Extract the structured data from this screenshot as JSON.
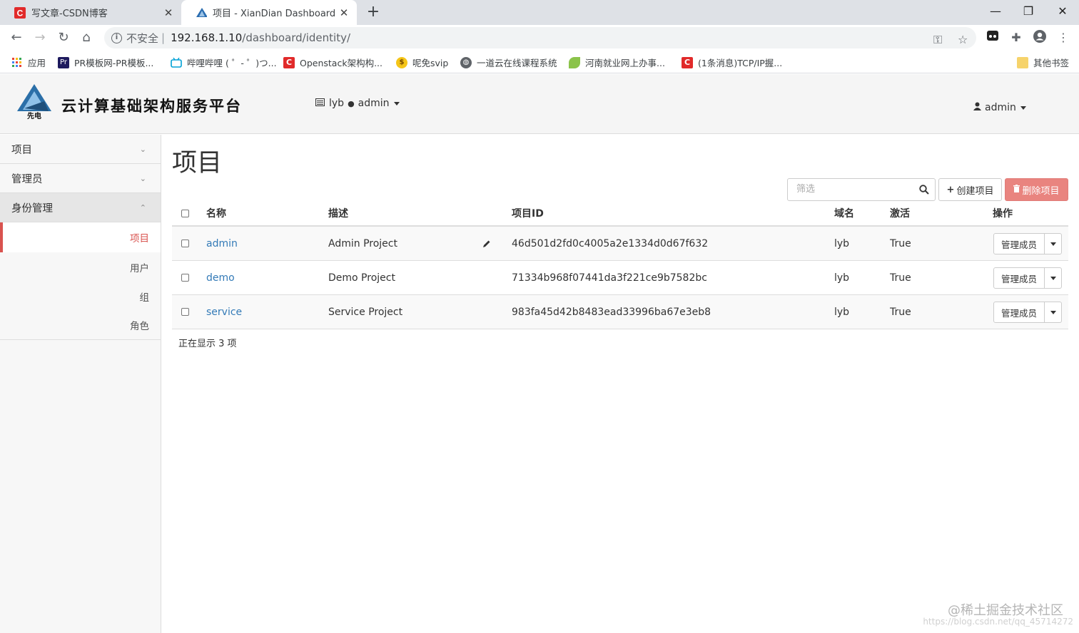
{
  "browser": {
    "tabs": [
      {
        "title": "写文章-CSDN博客",
        "icon": "csdn-icon",
        "active": false
      },
      {
        "title": "项目 - XianDian Dashboard",
        "icon": "openstack-icon",
        "active": true
      }
    ],
    "address": {
      "security_label": "不安全",
      "host": "192.168.1.10",
      "path": "/dashboard/identity/"
    },
    "bookmarks": [
      {
        "label": "应用",
        "icon": "apps-grid-icon"
      },
      {
        "label": "PR模板网-PR模板...",
        "icon": "premiere-icon"
      },
      {
        "label": "哔哩哔哩 ( ゜- ゜)つ...",
        "icon": "bilibili-icon"
      },
      {
        "label": "Openstack架构构...",
        "icon": "csdn-icon"
      },
      {
        "label": "呢免svip",
        "icon": "coin-icon"
      },
      {
        "label": "一道云在线课程系统",
        "icon": "globe-icon"
      },
      {
        "label": "河南就业网上办事...",
        "icon": "leaf-icon"
      },
      {
        "label": "(1条消息)TCP/IP握...",
        "icon": "csdn-icon"
      }
    ],
    "other_bookmarks": "其他书签"
  },
  "header": {
    "brand_title": "云计算基础架构服务平台",
    "context": {
      "domain": "lyb",
      "project": "admin"
    },
    "user": "admin"
  },
  "sidebar": {
    "sections": [
      {
        "label": "项目",
        "expanded": false
      },
      {
        "label": "管理员",
        "expanded": false
      },
      {
        "label": "身份管理",
        "expanded": true
      }
    ],
    "identity_items": [
      {
        "label": "项目",
        "active": true
      },
      {
        "label": "用户",
        "active": false
      },
      {
        "label": "组",
        "active": false
      },
      {
        "label": "角色",
        "active": false
      }
    ]
  },
  "main": {
    "title": "项目",
    "filter_placeholder": "筛选",
    "create_button": "创建项目",
    "delete_button": "删除项目",
    "columns": [
      "名称",
      "描述",
      "项目ID",
      "域名",
      "激活",
      "操作"
    ],
    "rows": [
      {
        "name": "admin",
        "description": "Admin Project",
        "id": "46d501d2fd0c4005a2e1334d0d67f632",
        "domain": "lyb",
        "enabled": "True",
        "action": "管理成员"
      },
      {
        "name": "demo",
        "description": "Demo Project",
        "id": "71334b968f07441da3f221ce9b7582bc",
        "domain": "lyb",
        "enabled": "True",
        "action": "管理成员"
      },
      {
        "name": "service",
        "description": "Service Project",
        "id": "983fa45d42b8483ead33996ba67e3eb8",
        "domain": "lyb",
        "enabled": "True",
        "action": "管理成员"
      }
    ],
    "count_text": "正在显示 3 项"
  },
  "watermark": {
    "text": "@稀土掘金技术社区",
    "url": "https://blog.csdn.net/qq_45714272"
  },
  "colors": {
    "accent": "#d9534f",
    "link": "#337ab7",
    "danger_button": "#e9847f"
  }
}
